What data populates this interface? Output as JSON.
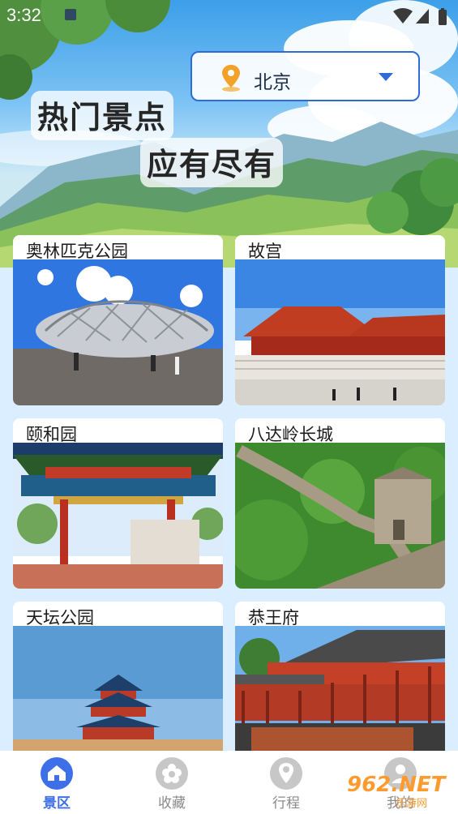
{
  "status_bar": {
    "time": "3:32"
  },
  "city_selector": {
    "city": "北京"
  },
  "slogan": {
    "line1": "热门景点",
    "line2": "应有尽有"
  },
  "attractions": [
    {
      "name": "奥林匹克公园"
    },
    {
      "name": "故宫"
    },
    {
      "name": "颐和园"
    },
    {
      "name": "八达岭长城"
    },
    {
      "name": "天坛公园"
    },
    {
      "name": "恭王府"
    }
  ],
  "bottom_nav": [
    {
      "label": "景区",
      "icon": "attractions-icon",
      "active": true
    },
    {
      "label": "收藏",
      "icon": "flower-icon",
      "active": false
    },
    {
      "label": "行程",
      "icon": "location-pin-icon",
      "active": false
    },
    {
      "label": "我的",
      "icon": "user-icon",
      "active": false
    }
  ],
  "watermark": {
    "text": "962.NET",
    "sub": "乐游网"
  },
  "colors": {
    "accent": "#3d6fe8",
    "sky": "#3c9fe8",
    "background": "#dbeeff"
  }
}
